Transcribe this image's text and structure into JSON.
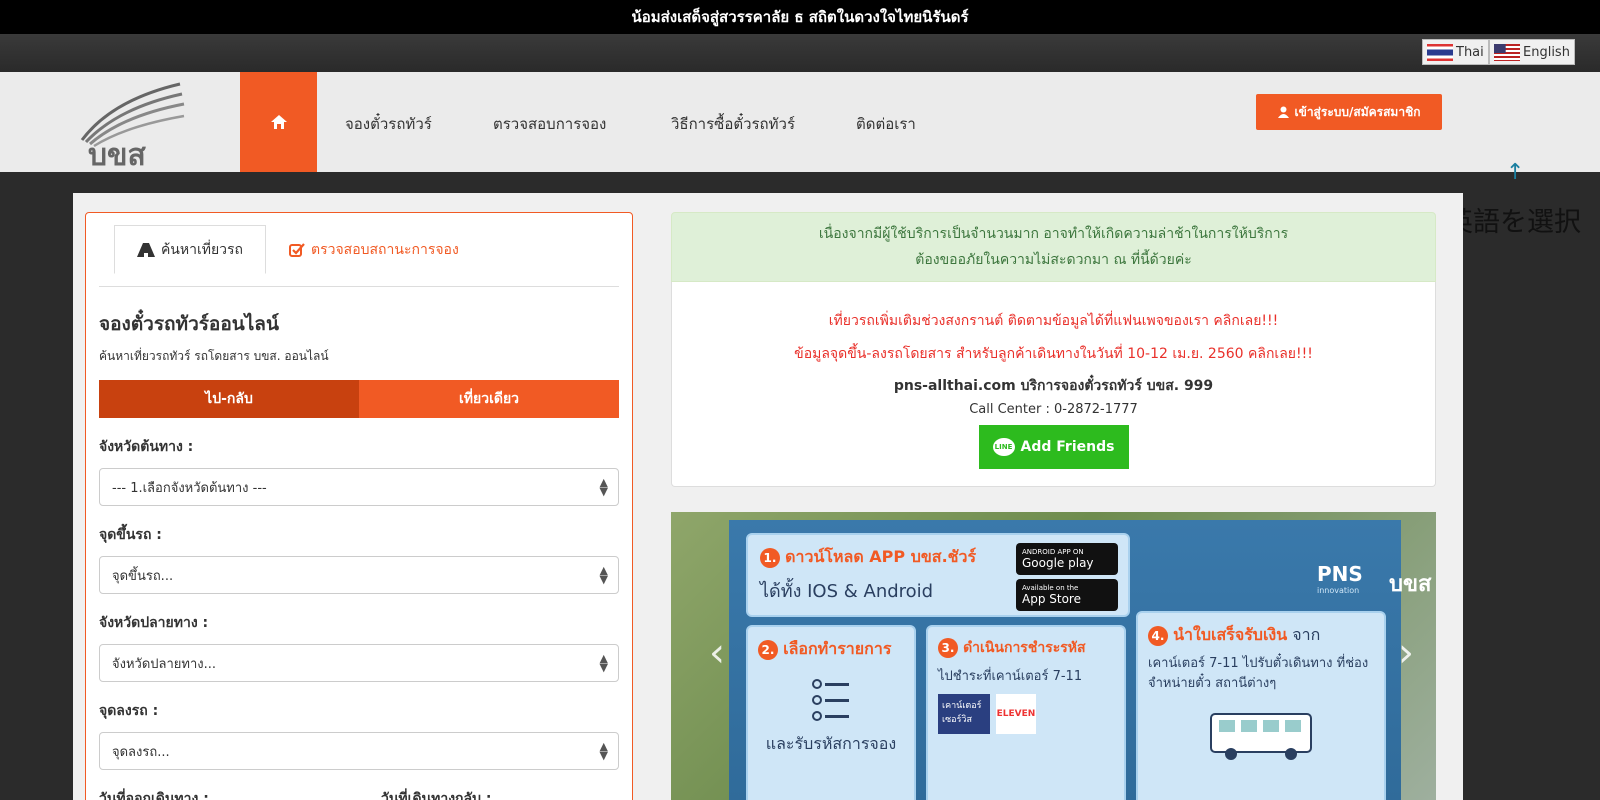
{
  "top_banner": "น้อมส่งเสด็จสู่สวรรคาลัย ธ สถิตในดวงใจไทยนิรันดร์",
  "language": {
    "thai_label": "Thai",
    "english_label": "English"
  },
  "logo_text": "บขส",
  "nav": {
    "home_icon": "home-icon",
    "items": [
      "จองตั๋วรถทัวร์",
      "ตรวจสอบการจอง",
      "วิธีการซื้อตั๋วรถทัวร์",
      "ติดต่อเรา"
    ],
    "login_label": "เข้าสู่ระบบ/สมัครสมาชิก"
  },
  "annotation": {
    "arrow": "↑",
    "text": "英語を選択"
  },
  "search": {
    "tab_search": "ค้นหาเที่ยวรถ",
    "tab_status": "ตรวจสอบสถานะการจอง",
    "title": "จองตั๋วรถทัวร์ออนไลน์",
    "subtitle": "ค้นหาเที่ยวรถทัวร์ รถโดยสาร บขส. ออนไลน์",
    "round_trip": "ไป-กลับ",
    "one_way": "เที่ยวเดียว",
    "origin_province_label": "จังหวัดต้นทาง :",
    "origin_province_value": "--- 1.เลือกจังหวัดต้นทาง ---",
    "pickup_label": "จุดขึ้นรถ :",
    "pickup_value": "จุดขึ้นรถ...",
    "dest_province_label": "จังหวัดปลายทาง :",
    "dest_province_value": "จังหวัดปลายทาง...",
    "dropoff_label": "จุดลงรถ :",
    "dropoff_value": "จุดลงรถ...",
    "depart_date_label": "วันที่ออกเดินทาง :",
    "return_date_label": "วันที่เดินทางกลับ :"
  },
  "notice": {
    "line1": "เนื่องจากมีผู้ใช้บริการเป็นจำนวนมาก อาจทำให้เกิดความล่าช้าในการให้บริการ",
    "line2": "ต้องขออภัยในความไม่สะดวกมา ณ ที่นี้ด้วยค่ะ"
  },
  "info": {
    "red1": "เที่ยวรถเพิ่มเติมช่วงสงกรานต์ ติดตามข้อมูลได้ที่แฟนเพจของเรา คลิกเลย!!!",
    "red2": "ข้อมูลจุดขึ้น-ลงรถโดยสาร สำหรับลูกค้าเดินทางในวันที่ 10-12 เม.ย. 2560 คลิกเลย!!!",
    "site": "pns-allthai.com บริการจองตั๋วรถทัวร์ บขส. 999",
    "call_center": "Call Center : 0-2872-1777",
    "add_friends": "Add Friends",
    "line_badge": "LINE"
  },
  "banner": {
    "step1_num": "1.",
    "step1_title": "ดาวน์โหลด APP บขส.ชัวร์",
    "step1_sub": "ได้ทั้ง IOS & Android",
    "google_small": "ANDROID APP ON",
    "google_play": "Google play",
    "appstore_small": "Available on the",
    "app_store": "App Store",
    "step2_num": "2.",
    "step2_title": "เลือกทำรายการ",
    "step2_sub": "และรับรหัสการจอง",
    "step3_num": "3.",
    "step3_title": "ดำเนินการชำระรหัส",
    "step3_sub": "ไปชำระที่เคาน์เตอร์ 7-11",
    "counter_service": "เคาน์เตอร์ เซอร์วิส",
    "eleven": "ELEVEN",
    "step4_num": "4.",
    "step4_title": "นำใบเสร็จรับเงิน",
    "step4_title_tail": "จาก",
    "step4_sub": "เคาน์เตอร์ 7-11 ไปรับตั๋วเดินทาง ที่ช่องจำหน่ายตั๋ว สถานีต่างๆ",
    "pns_text": "PNS",
    "pns_sub": "innovation",
    "pns_logo_text": "บขส"
  },
  "colors": {
    "accent": "#f15a24",
    "notice_bg": "#dff0d8",
    "line_green": "#2dbb1e"
  }
}
